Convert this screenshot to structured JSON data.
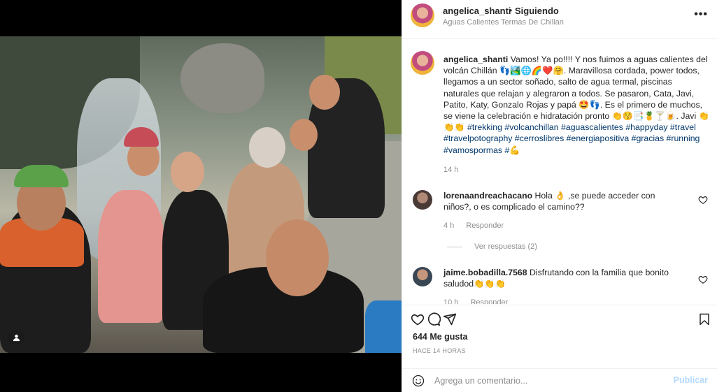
{
  "header": {
    "username": "angelica_shanti",
    "dot": "•",
    "follow_label": "Siguiendo",
    "location": "Aguas Calientes Termas De Chillan",
    "more": "•••"
  },
  "caption": {
    "username": "angelica_shanti",
    "text": "Vamos! Ya po!!!! Y nos fuimos a aguas calientes del volcán Chillán 👣🏞️🌐🌈❤️🤗. Maravillosa cordada, power todos, llegamos a un sector soñado, salto de agua termal, piscinas naturales que relajan y alegraron a todos. Se pasaron, Cata, Javi, Patito, Katy, Gonzalo Rojas y papá 🤩👣. Es el primero de muchos, se viene la celebración e hidratación pronto 👏😚📑🍍🍸🍺. Javi 👏👏👏",
    "hashtags": "#trekking #volcanchillan #aguascalientes #happyday #travel #travelpotography #cerroslibres #energiapositiva #gracias #running #vamospormas #💪",
    "time": "14 h"
  },
  "comments": [
    {
      "username": "lorenaandreachacano",
      "text": "Hola 👌 ,se puede acceder con niños?, o es complicado el camino??",
      "time": "4 h",
      "reply_label": "Responder"
    },
    {
      "username": "jaime.bobadilla.7568",
      "text": "Disfrutando con la familia que bonito saludod👏👏👏",
      "time": "10 h",
      "reply_label": "Responder"
    }
  ],
  "view_replies": "Ver respuestas (2)",
  "likes": "644 Me gusta",
  "posted_ago": "HACE 14 HORAS",
  "add_comment": {
    "placeholder": "Agrega un comentario...",
    "post_label": "Publicar"
  },
  "icons": {
    "like": "heart-icon",
    "comment": "comment-icon",
    "share": "paper-plane-icon",
    "save": "bookmark-icon",
    "emoji": "smiley-icon",
    "tagged": "person-icon"
  }
}
